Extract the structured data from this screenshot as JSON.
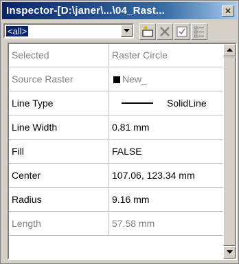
{
  "window": {
    "title": "Inspector-[D:\\janer\\...\\04_Rast...",
    "close_glyph": "✕"
  },
  "toolbar": {
    "filter_value": "<all>",
    "icons": [
      "new-item-icon",
      "delete-icon",
      "checkbox-icon",
      "list-icon"
    ]
  },
  "properties": [
    {
      "key": "Selected",
      "value": "Raster Circle",
      "enabled": false
    },
    {
      "key": "Source Raster",
      "value": "New_",
      "enabled": false,
      "swatch": "#000000"
    },
    {
      "key": "Line Type",
      "value": "SolidLine",
      "enabled": true,
      "line_sample": true
    },
    {
      "key": "Line Width",
      "value": "0.81 mm",
      "enabled": true
    },
    {
      "key": "Fill",
      "value": "FALSE",
      "enabled": true
    },
    {
      "key": "Center",
      "value": "107.06, 123.34 mm",
      "enabled": true
    },
    {
      "key": "Radius",
      "value": "9.16 mm",
      "enabled": true
    },
    {
      "key": "Length",
      "value": "57.58 mm",
      "enabled": false
    }
  ],
  "colors": {
    "titlebar_start": "#0a246a",
    "titlebar_end": "#a6caf0",
    "face": "#d4d0c8",
    "disabled_text": "#808080"
  }
}
